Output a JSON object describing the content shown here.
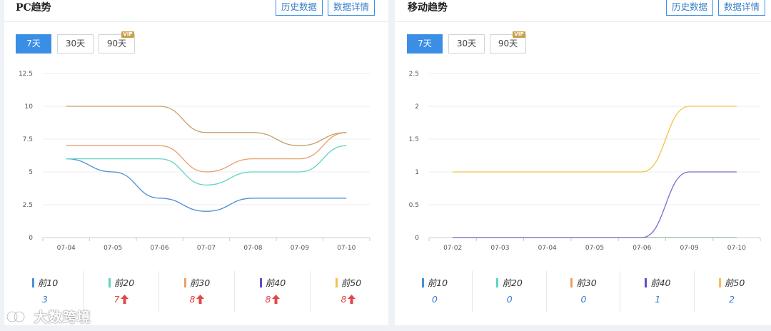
{
  "colors": {
    "accent": "#3a8ee6",
    "up": "#e3474a",
    "series": [
      "#4a90d9",
      "#5fd4c0",
      "#e8a06a",
      "#5b4fc6",
      "#f3c24e"
    ]
  },
  "pc": {
    "title": "PC趋势",
    "history_button": "历史数据",
    "detail_button": "数据详情",
    "range_tabs": [
      {
        "label": "7天",
        "active": true,
        "vip": false
      },
      {
        "label": "30天",
        "active": false,
        "vip": false
      },
      {
        "label": "90天",
        "active": false,
        "vip": true
      }
    ],
    "vip_label": "VIP",
    "summary": [
      {
        "label": "前10",
        "value": "3",
        "trend": "none"
      },
      {
        "label": "前20",
        "value": "7",
        "trend": "up"
      },
      {
        "label": "前30",
        "value": "8",
        "trend": "up"
      },
      {
        "label": "前40",
        "value": "8",
        "trend": "up"
      },
      {
        "label": "前50",
        "value": "8",
        "trend": "up"
      }
    ]
  },
  "mobile": {
    "title": "移动趋势",
    "history_button": "历史数据",
    "detail_button": "数据详情",
    "range_tabs": [
      {
        "label": "7天",
        "active": true,
        "vip": false
      },
      {
        "label": "30天",
        "active": false,
        "vip": false
      },
      {
        "label": "90天",
        "active": false,
        "vip": true
      }
    ],
    "vip_label": "VIP",
    "summary": [
      {
        "label": "前10",
        "value": "0",
        "trend": "none"
      },
      {
        "label": "前20",
        "value": "0",
        "trend": "none"
      },
      {
        "label": "前30",
        "value": "0",
        "trend": "none"
      },
      {
        "label": "前40",
        "value": "1",
        "trend": "none"
      },
      {
        "label": "前50",
        "value": "2",
        "trend": "none"
      }
    ]
  },
  "chart_data": [
    {
      "type": "line",
      "categories": [
        "07-04",
        "07-05",
        "07-06",
        "07-07",
        "07-08",
        "07-09",
        "07-10"
      ],
      "ylim": [
        0,
        12.5
      ],
      "yticks": [
        "0",
        "2.5",
        "5",
        "7.5",
        "10",
        "12.5"
      ],
      "grid": true,
      "series": [
        {
          "values": [
            6,
            5,
            3,
            2,
            3,
            3,
            3
          ],
          "color": "#4a90d9"
        },
        {
          "values": [
            6,
            6,
            6,
            4,
            5,
            5,
            7
          ],
          "color": "#5fd4c0"
        },
        {
          "values": [
            7,
            7,
            7,
            5,
            6,
            6,
            8
          ],
          "color": "#e8a06a"
        },
        {
          "values": [
            10,
            10,
            10,
            8,
            8,
            7,
            8
          ],
          "color": "#c8a070"
        }
      ]
    },
    {
      "type": "line",
      "categories": [
        "07-02",
        "07-03",
        "07-04",
        "07-05",
        "07-06",
        "07-09",
        "07-10"
      ],
      "ylim": [
        0,
        2.5
      ],
      "yticks": [
        "0",
        "0.5",
        "1",
        "1.5",
        "2",
        "2.5"
      ],
      "grid": true,
      "series": [
        {
          "values": [
            0,
            0,
            0,
            0,
            0,
            0,
            0
          ],
          "color": "#8fb7a4"
        },
        {
          "values": [
            0,
            0,
            0,
            0,
            0,
            1,
            1
          ],
          "color": "#7e6cc9"
        },
        {
          "values": [
            1,
            1,
            1,
            1,
            1,
            2,
            2
          ],
          "color": "#f3c24e"
        }
      ]
    }
  ],
  "watermark": "大数跨境"
}
